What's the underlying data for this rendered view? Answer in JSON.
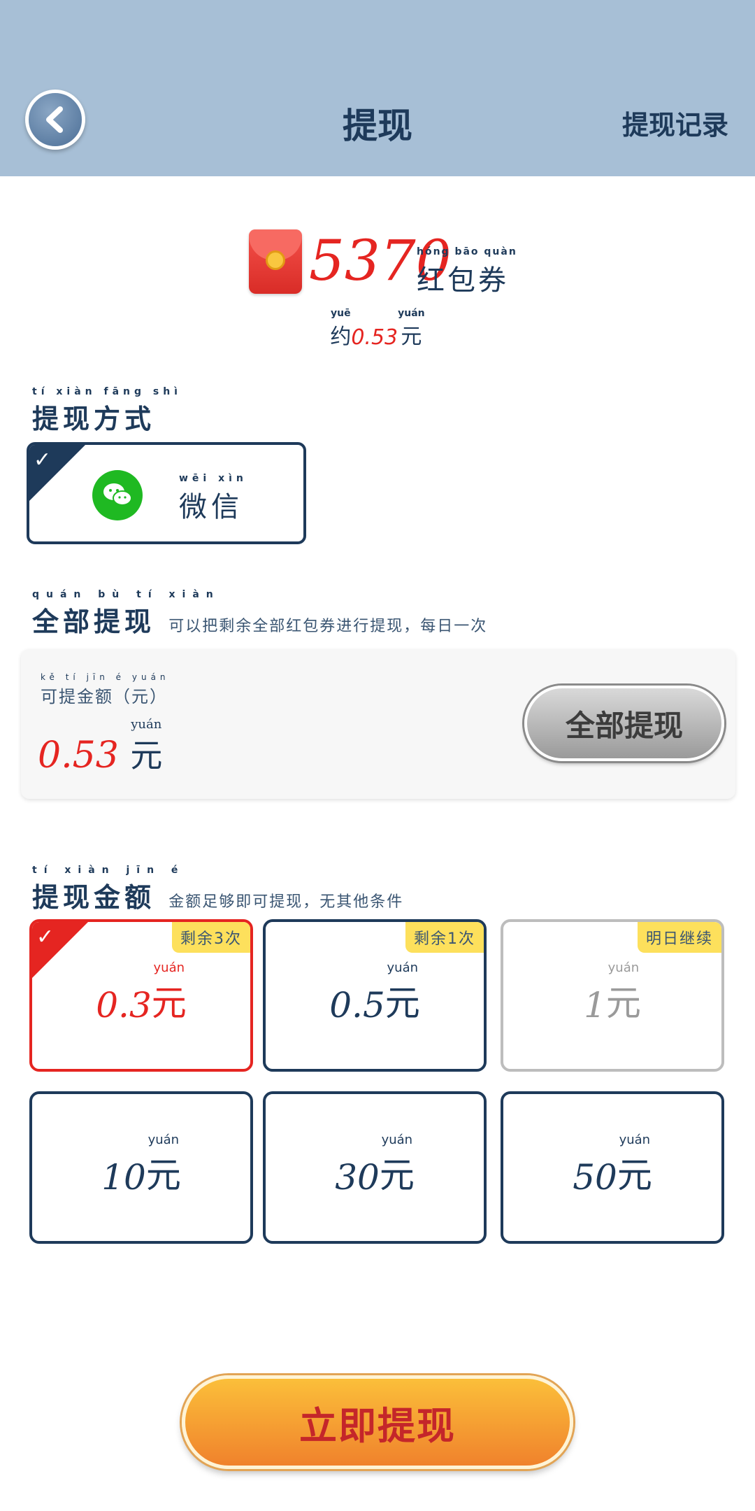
{
  "header": {
    "title": "提现",
    "records_label": "提现记录"
  },
  "coupon": {
    "amount": "5370",
    "label": "红包券",
    "label_pinyin": "hóng bāo quàn",
    "approx_prefix": "约",
    "approx_prefix_pinyin": "yuē",
    "approx_value": "0.53",
    "approx_unit": "元",
    "approx_unit_pinyin": "yuán"
  },
  "method_section": {
    "title": "提现方式",
    "title_pinyin": "tí xiàn fāng shì",
    "method": {
      "label": "微信",
      "pinyin": "wēi xìn",
      "icon": "wechat-icon",
      "selected": true
    }
  },
  "full_section": {
    "title": "全部提现",
    "title_pinyin": "quán bù tí xiàn",
    "note": "可以把剩余全部红包券进行提现，每日一次",
    "available_label": "可提金额（元）",
    "available_label_pinyin": "kě tí jīn é yuán",
    "available_amount": "0.53",
    "available_unit": "元",
    "available_unit_pinyin": "yuán",
    "button_label": "全部提现"
  },
  "amount_section": {
    "title": "提现金额",
    "title_pinyin": "tí xiàn jīn é",
    "note": "金额足够即可提现，无其他条件",
    "unit_pinyin": "yuán",
    "options": [
      {
        "value": "0.3",
        "unit": "元",
        "tag": "剩余3次",
        "state": "selected"
      },
      {
        "value": "0.5",
        "unit": "元",
        "tag": "剩余1次",
        "state": "normal"
      },
      {
        "value": "1",
        "unit": "元",
        "tag": "明日继续",
        "state": "disabled"
      },
      {
        "value": "10",
        "unit": "元",
        "tag": "",
        "state": "normal"
      },
      {
        "value": "30",
        "unit": "元",
        "tag": "",
        "state": "normal"
      },
      {
        "value": "50",
        "unit": "元",
        "tag": "",
        "state": "normal"
      }
    ]
  },
  "submit_button": {
    "label": "立即提现"
  },
  "colors": {
    "header_bg": "#a7bfd6",
    "primary_text": "#1e3a5a",
    "accent_red": "#e52521",
    "button_orange": "#f0822c",
    "tag_yellow": "#fde05c",
    "wechat_green": "#1fb922"
  }
}
